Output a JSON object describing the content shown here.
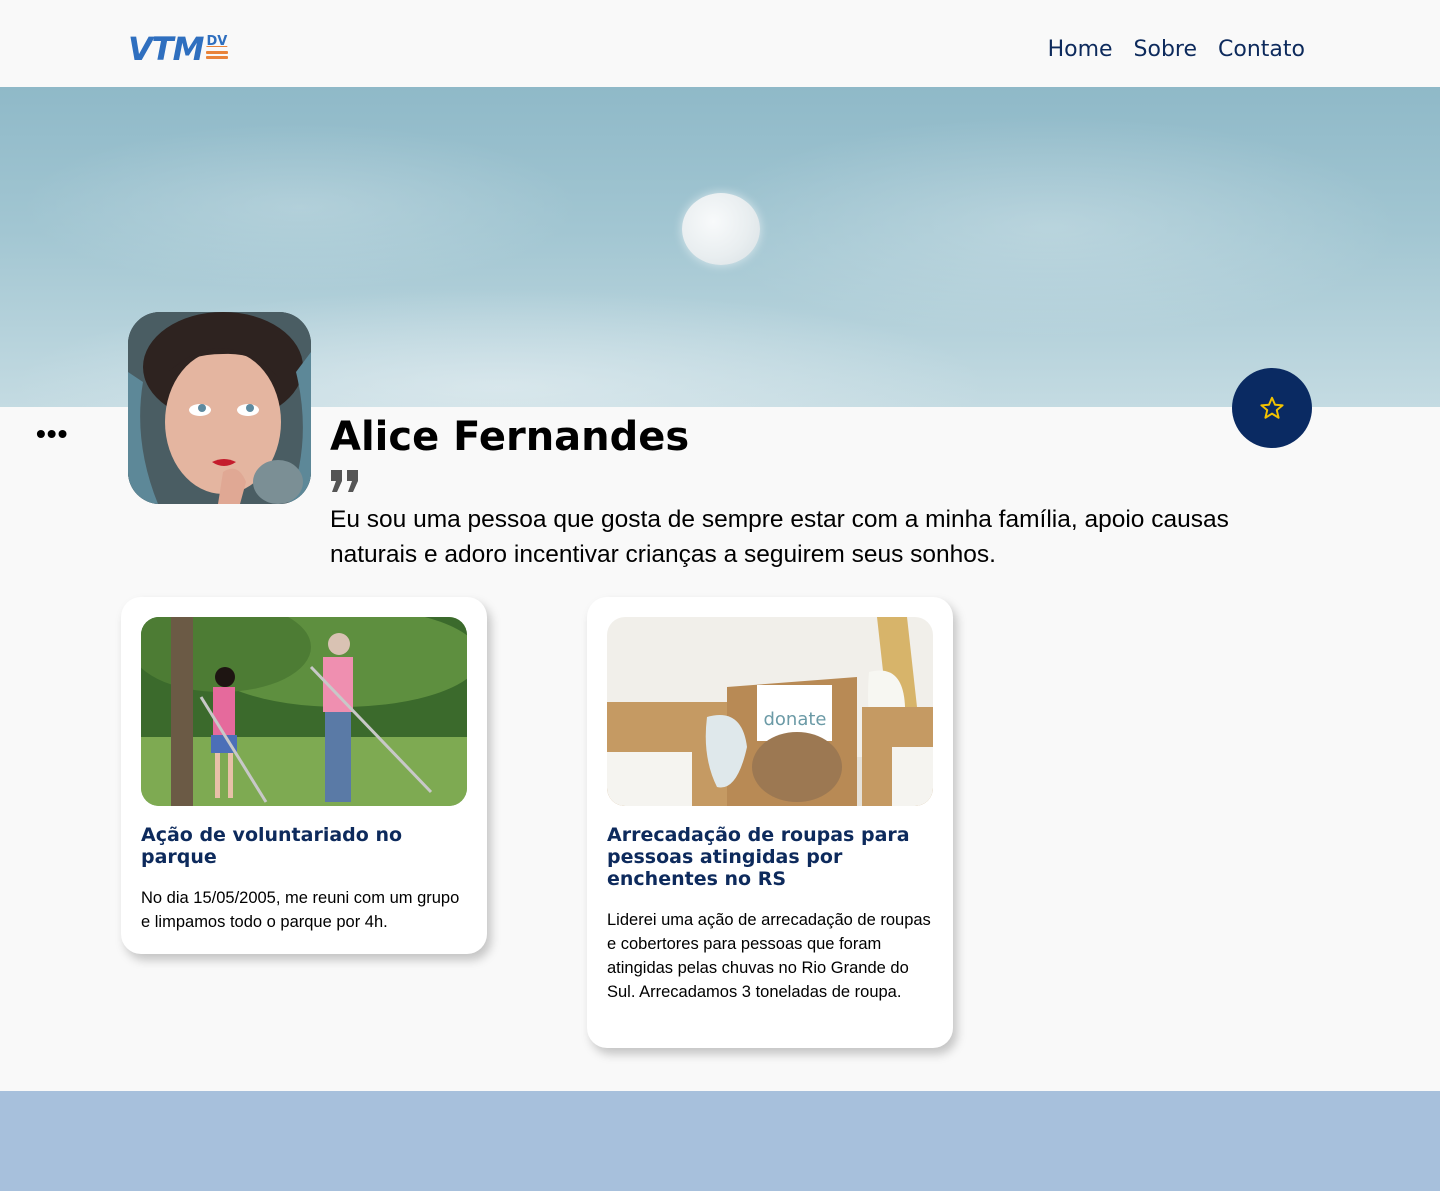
{
  "header": {
    "logo_text": "VTM",
    "logo_sup": "DV",
    "nav": [
      "Home",
      "Sobre",
      "Contato"
    ]
  },
  "profile": {
    "name": "Alice Fernandes",
    "bio": "Eu sou uma pessoa que gosta de sempre estar com a minha família, apoio causas naturais e adoro incentivar crianças a seguirem seus sonhos.",
    "more_icon": "ellipsis-icon",
    "favorite_icon": "star-icon"
  },
  "cards": [
    {
      "title": "Ação de voluntariado no parque",
      "text": "No dia 15/05/2005, me reuni com um grupo e limpamos todo o parque por 4h.",
      "image": "park-volunteering-photo"
    },
    {
      "title": "Arrecadação de roupas para pessoas atingidas por enchentes no RS",
      "text": "Liderei uma ação de arrecadação de roupas e cobertores para pessoas que foram atingidas pelas chuvas no Rio Grande do Sul. Arrecadamos 3 toneladas de roupa.",
      "image": "donation-boxes-photo",
      "image_label": "donate"
    }
  ],
  "colors": {
    "primary": "#0a2a62",
    "logo_blue": "#2f6fbf",
    "logo_orange": "#e9833a",
    "star": "#f2c200",
    "footer": "#a7c0dc"
  }
}
